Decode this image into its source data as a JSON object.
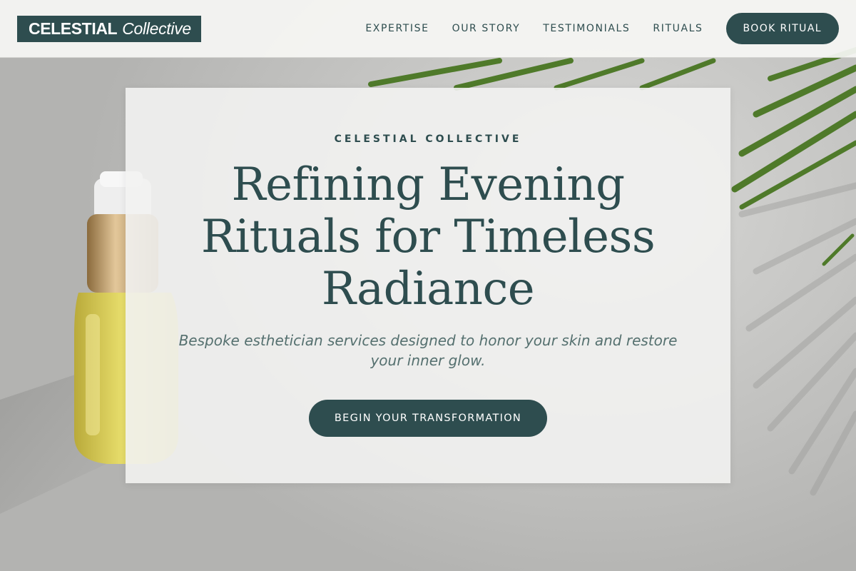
{
  "brand": {
    "name_strong": "CELESTIAL",
    "name_italic": "Collective"
  },
  "nav": {
    "items": [
      {
        "label": "EXPERTISE"
      },
      {
        "label": "OUR STORY"
      },
      {
        "label": "TESTIMONIALS"
      },
      {
        "label": "RITUALS"
      }
    ],
    "cta_label": "BOOK RITUAL"
  },
  "hero": {
    "eyebrow": "CELESTIAL COLLECTIVE",
    "headline": "Refining Evening Rituals for Timeless Radiance",
    "subhead": "Bespoke esthetician services designed to honor your skin and restore your inner glow.",
    "cta_label": "BEGIN YOUR TRANSFORMATION"
  },
  "colors": {
    "accent": "#2e4d4f",
    "card_background": "#f2f2f1",
    "subhead_text": "#55706f"
  }
}
